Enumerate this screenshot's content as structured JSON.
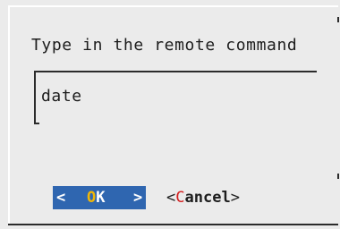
{
  "dialog": {
    "prompt": "Type in the remote command",
    "input_value": "date"
  },
  "buttons": {
    "ok": {
      "left_arrow": "<",
      "hotkey": "O",
      "rest": "K",
      "right_arrow": ">"
    },
    "cancel": {
      "open_bracket": "<",
      "hotkey": "C",
      "rest": "ancel",
      "close_bracket": ">"
    }
  },
  "colors": {
    "background": "#ebebeb",
    "selected_button_bg": "#2f66b0",
    "selected_hotkey": "#f2b705",
    "hotkey": "#d42020",
    "text": "#1d1d1d"
  }
}
